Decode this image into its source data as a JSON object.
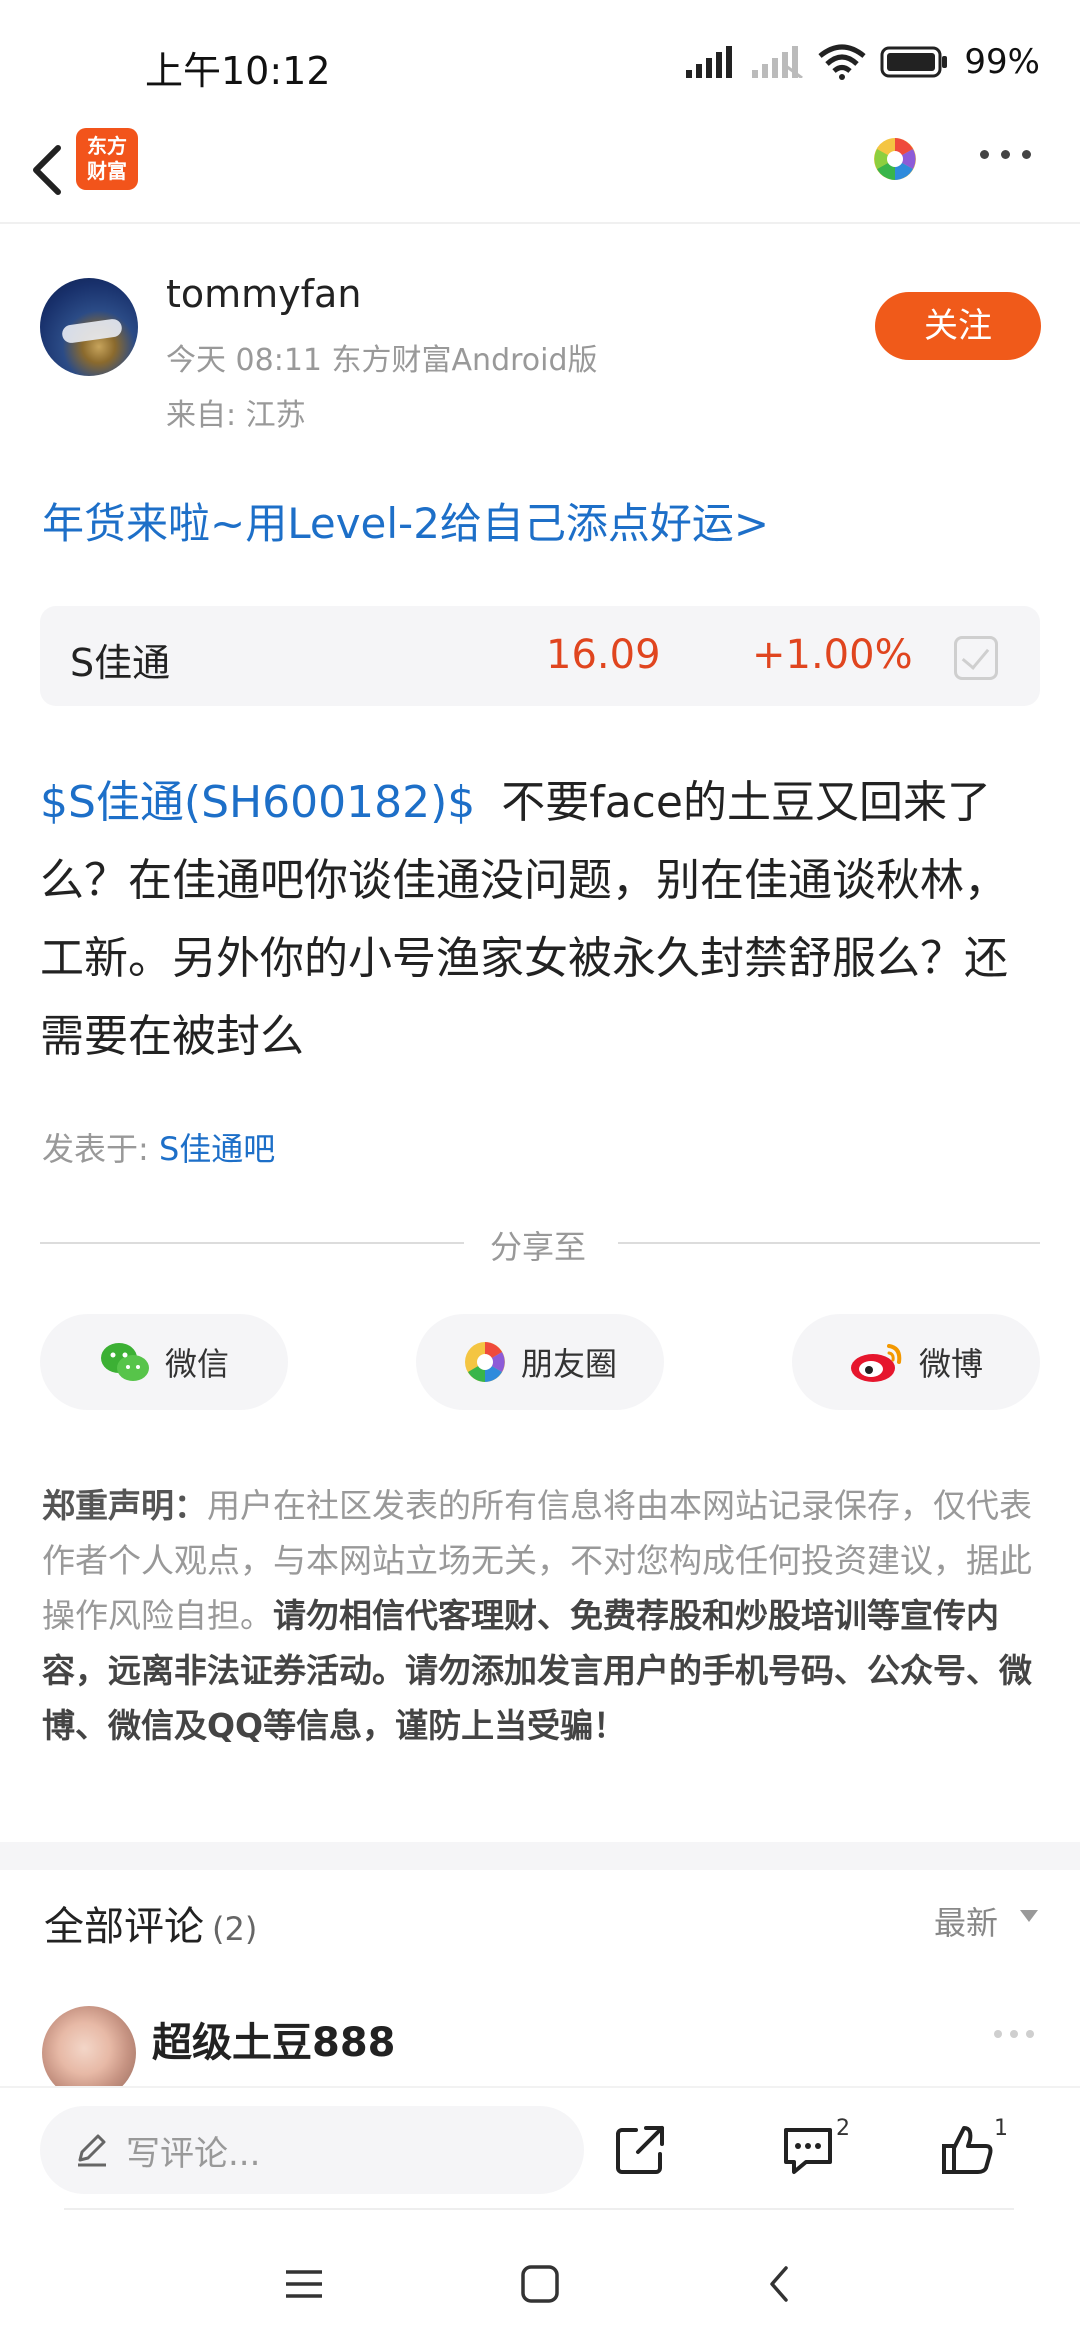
{
  "status_bar": {
    "time": "上午10:12",
    "battery_text": "99%"
  },
  "nav": {
    "logo_line1": "东方",
    "logo_line2": "财富",
    "icons": [
      "back-chevron-icon",
      "color-wheel-icon",
      "more-dots-icon"
    ]
  },
  "author": {
    "name": "tommyfan",
    "meta": "今天 08:11 东方财富Android版",
    "from": "来自: 江苏",
    "follow_label": "关注"
  },
  "promo_link": "年货来啦~用Level-2给自己添点好运>",
  "stock": {
    "name": "S佳通",
    "price": "16.09",
    "change": "+1.00%"
  },
  "post": {
    "tag": "$S佳通(SH600182)$",
    "text": "不要face的土豆又回来了么？在佳通吧你谈佳通没问题，别在佳通谈秋林，工新。另外你的小号渔家女被永久封禁舒服么？还需要在被封么",
    "posted_in_label": "发表于: ",
    "posted_in_bar": "S佳通吧"
  },
  "share": {
    "label": "分享至",
    "wechat": "微信",
    "moments": "朋友圈",
    "weibo": "微博"
  },
  "disclaimer": {
    "title": "郑重声明：",
    "text": "用户在社区发表的所有信息将由本网站记录保存，仅代表作者个人观点，与本网站立场无关，不对您构成任何投资建议，据此操作风险自担。",
    "warning": "请勿相信代客理财、免费荐股和炒股培训等宣传内容，远离非法证券活动。请勿添加发言用户的手机号码、公众号、微博、微信及QQ等信息，谨防上当受骗！"
  },
  "comments": {
    "title": "全部评论",
    "count": "(2)",
    "sort": "最新",
    "first_commenter": "超级土豆888"
  },
  "bottom_bar": {
    "placeholder": "写评论...",
    "comment_count": "2",
    "like_count": "1"
  },
  "colors": {
    "brand_orange": "#f05a1a",
    "link_blue": "#1d6fc8",
    "stock_red": "#e0451f"
  }
}
